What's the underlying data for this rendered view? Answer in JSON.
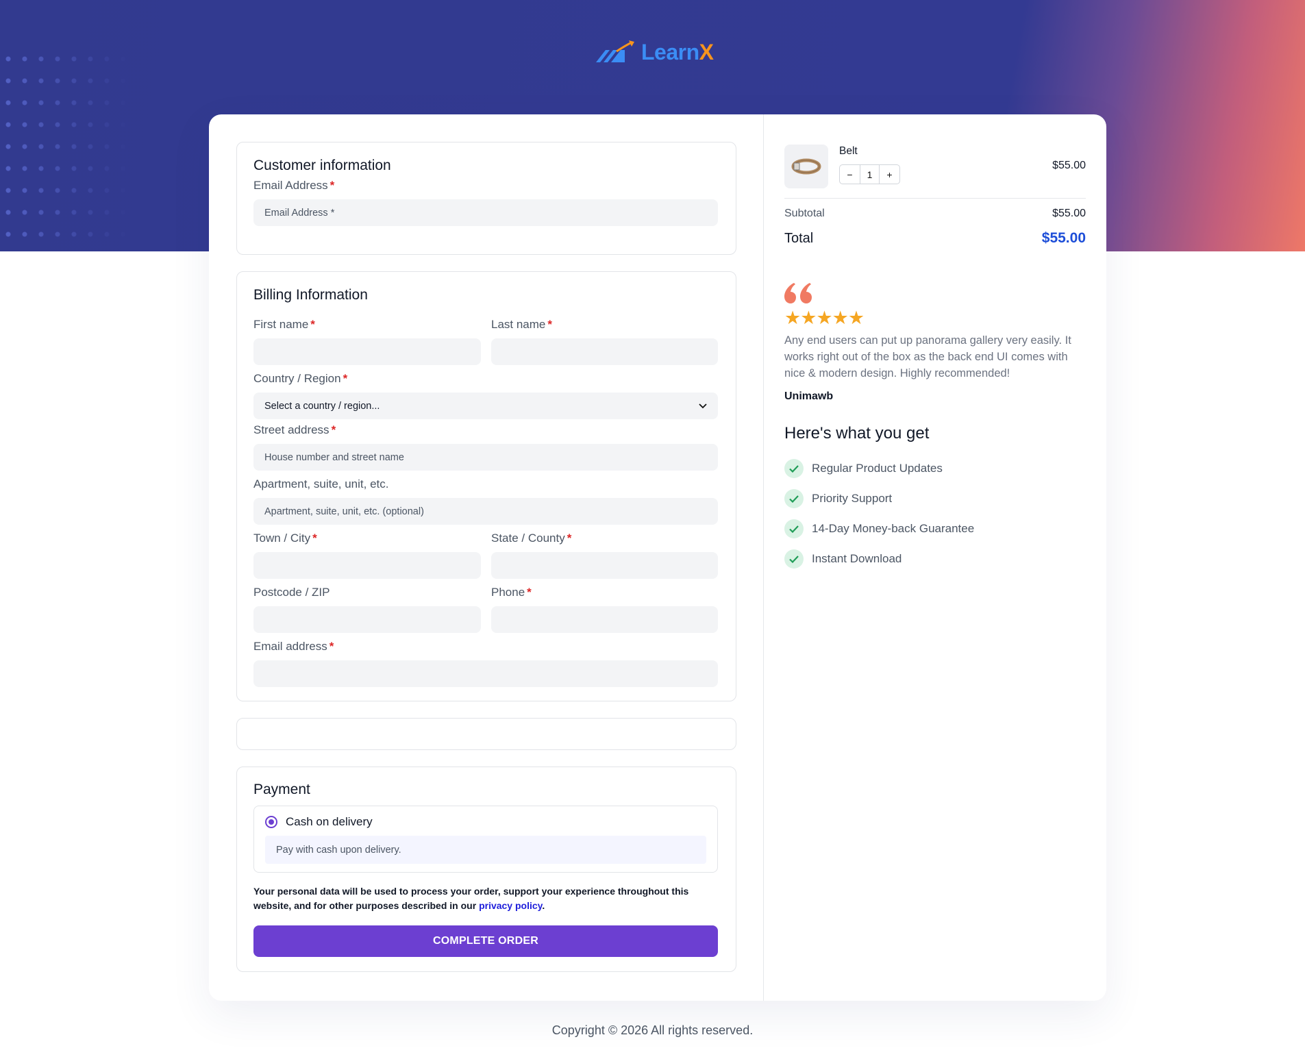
{
  "brand": {
    "name_main": "Learn",
    "name_accent": "X"
  },
  "customer": {
    "title": "Customer information",
    "email_label": "Email Address",
    "email_placeholder": "Email Address *"
  },
  "billing": {
    "title": "Billing Information",
    "first_name_label": "First name",
    "last_name_label": "Last name",
    "country_label": "Country / Region",
    "country_value": "Select a country / region...",
    "street_label": "Street address",
    "street_placeholder": "House number and street name",
    "apartment_label": "Apartment, suite, unit, etc.",
    "apartment_placeholder": "Apartment, suite, unit, etc. (optional)",
    "city_label": "Town / City",
    "state_label": "State / County",
    "postcode_label": "Postcode / ZIP",
    "phone_label": "Phone",
    "email_label": "Email address",
    "required_mark": "*"
  },
  "payment": {
    "title": "Payment",
    "method_label": "Cash on delivery",
    "method_description": "Pay with cash upon delivery.",
    "privacy_text": "Your personal data will be used to process your order, support your experience throughout this website, and for other purposes described in our",
    "privacy_link": "privacy policy",
    "privacy_end": ".",
    "submit_label": "COMPLETE ORDER"
  },
  "order": {
    "item_name": "Belt",
    "quantity": "1",
    "minus": "−",
    "plus": "+",
    "item_price": "$55.00",
    "subtotal_label": "Subtotal",
    "subtotal_value": "$55.00",
    "total_label": "Total",
    "total_value": "$55.00"
  },
  "testimonial": {
    "rating": 5,
    "stars": "★★★★★",
    "text": "Any end users can put up panorama gallery very easily. It works right out of the box as the back end UI comes with nice & modern design. Highly recommended!",
    "author": "Unimawb"
  },
  "benefits": {
    "title": "Here's what you get",
    "items": [
      "Regular Product Updates",
      "Priority Support",
      "14-Day Money-back Guarantee",
      "Instant Download"
    ]
  },
  "footer": {
    "copyright": "Copyright © 2026 All rights reserved."
  },
  "colors": {
    "hero_bg": "#333a92",
    "accent_purple": "#6c3fd1",
    "total_blue": "#1d4ed8",
    "quote_coral": "#f07a62",
    "star_gold": "#f5a623",
    "check_green": "#1f9d57"
  }
}
